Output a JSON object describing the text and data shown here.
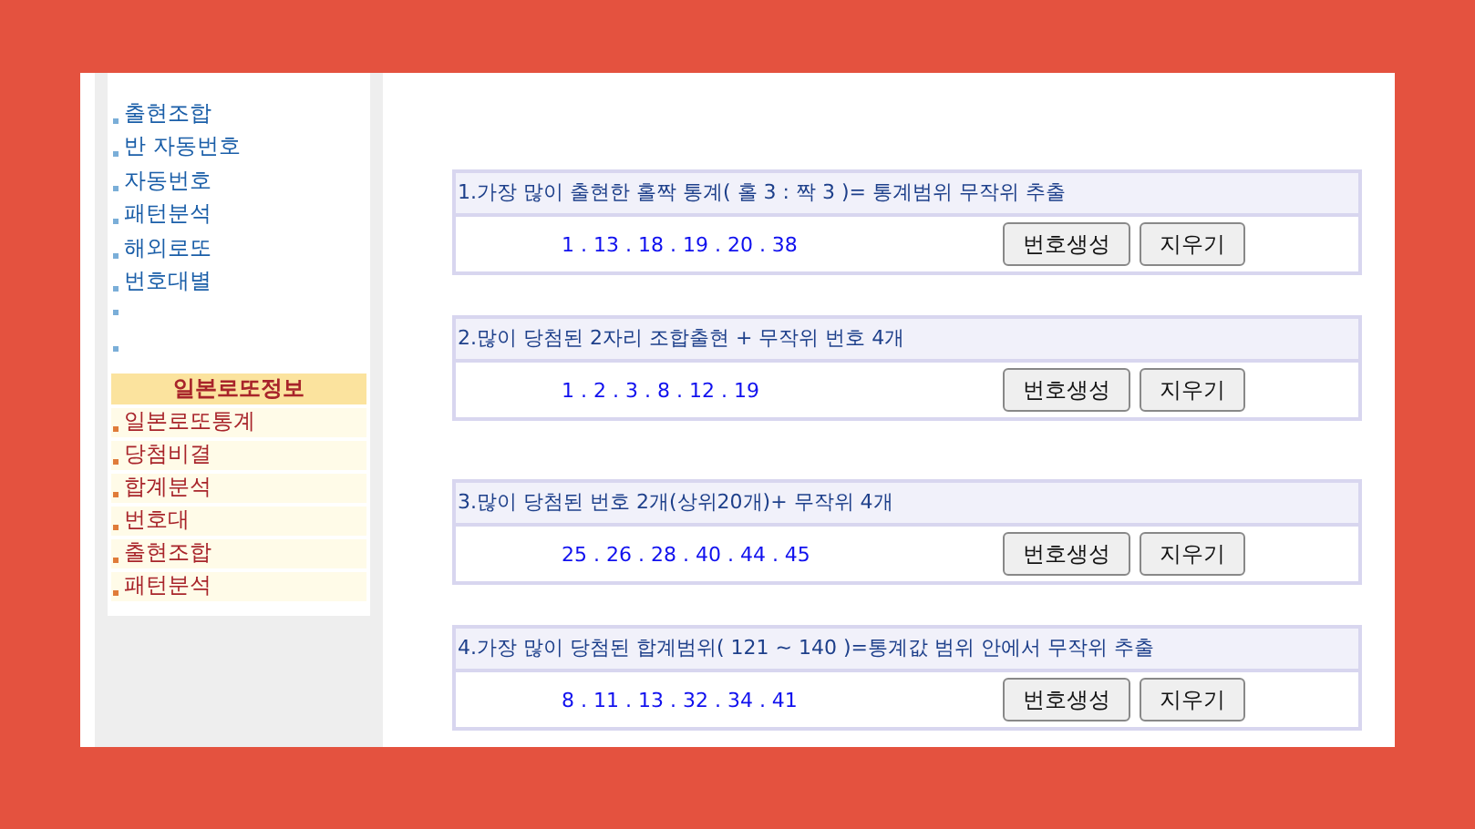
{
  "sidebar": {
    "items": [
      {
        "kind": "link",
        "label": "출현조합"
      },
      {
        "kind": "link",
        "label": "반 자동번호"
      },
      {
        "kind": "link",
        "label": "자동번호"
      },
      {
        "kind": "link",
        "label": "패턴분석"
      },
      {
        "kind": "link",
        "label": "해외로또"
      },
      {
        "kind": "link",
        "label": "번호대별"
      },
      {
        "kind": "blank"
      },
      {
        "kind": "blank"
      }
    ],
    "section": {
      "title": "일본로또정보",
      "items": [
        {
          "label": "일본로또통계"
        },
        {
          "label": "당첨비결"
        },
        {
          "label": "합계분석"
        },
        {
          "label": "번호대"
        },
        {
          "label": "출현조합"
        },
        {
          "label": "패턴분석"
        }
      ]
    }
  },
  "panels": [
    {
      "title": "1.가장 많이 출현한 홀짝 통계( 홀 3 : 짝 3 )= 통계범위 무작위 추출",
      "numbers": "1 . 13 . 18 . 19 . 20 . 38",
      "buttons": [
        "번호생성",
        "지우기"
      ]
    },
    {
      "title": "2.많이 당첨된 2자리 조합출현 + 무작위 번호 4개",
      "numbers": "1 . 2 . 3 . 8 . 12 . 19",
      "buttons": [
        "번호생성",
        "지우기"
      ]
    },
    {
      "title": "3.많이 당첨된 번호 2개(상위20개)+ 무작위 4개",
      "numbers": "25 . 26 . 28 . 40 . 44 . 45",
      "buttons": [
        "번호생성",
        "지우기"
      ]
    },
    {
      "title": "4.가장 많이 당첨된 합계범위( 121 ~ 140 )=통계값 범위 안에서 무작위 추출",
      "numbers": "8 . 11 . 13 . 32 . 34 . 41",
      "buttons": [
        "번호생성",
        "지우기"
      ]
    }
  ]
}
